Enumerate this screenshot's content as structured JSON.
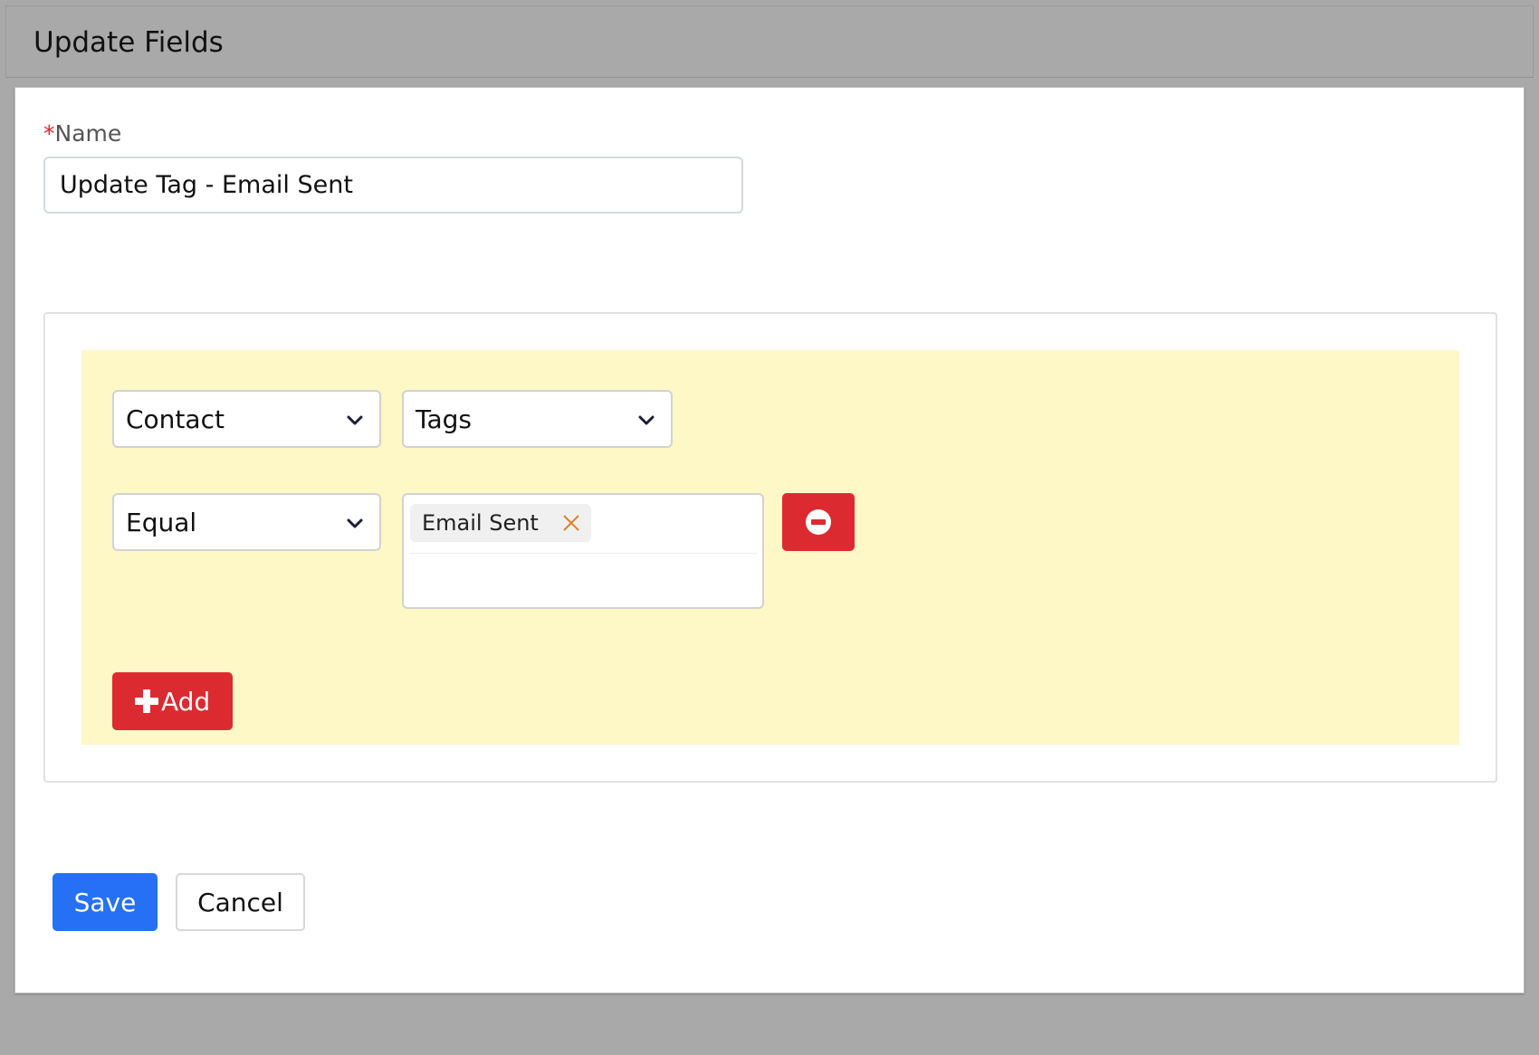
{
  "header": {
    "title": "Update Fields"
  },
  "form": {
    "name_required_marker": "*",
    "name_label": "Name",
    "name_value": "Update Tag - Email Sent"
  },
  "rule": {
    "object_select": "Contact",
    "field_select": "Tags",
    "operator_select": "Equal",
    "values": [
      "Email Sent"
    ]
  },
  "buttons": {
    "add_label": "Add",
    "save_label": "Save",
    "cancel_label": "Cancel"
  },
  "icons": {
    "chevron": "chevron-down-icon",
    "remove": "minus-circle-icon",
    "plus": "plus-icon",
    "chip_close": "close-icon"
  },
  "colors": {
    "primary": "#2670f5",
    "danger": "#dc2a31",
    "rule_background": "#fdf8c6",
    "required": "#d9232d",
    "chip_close": "#d9822b"
  }
}
